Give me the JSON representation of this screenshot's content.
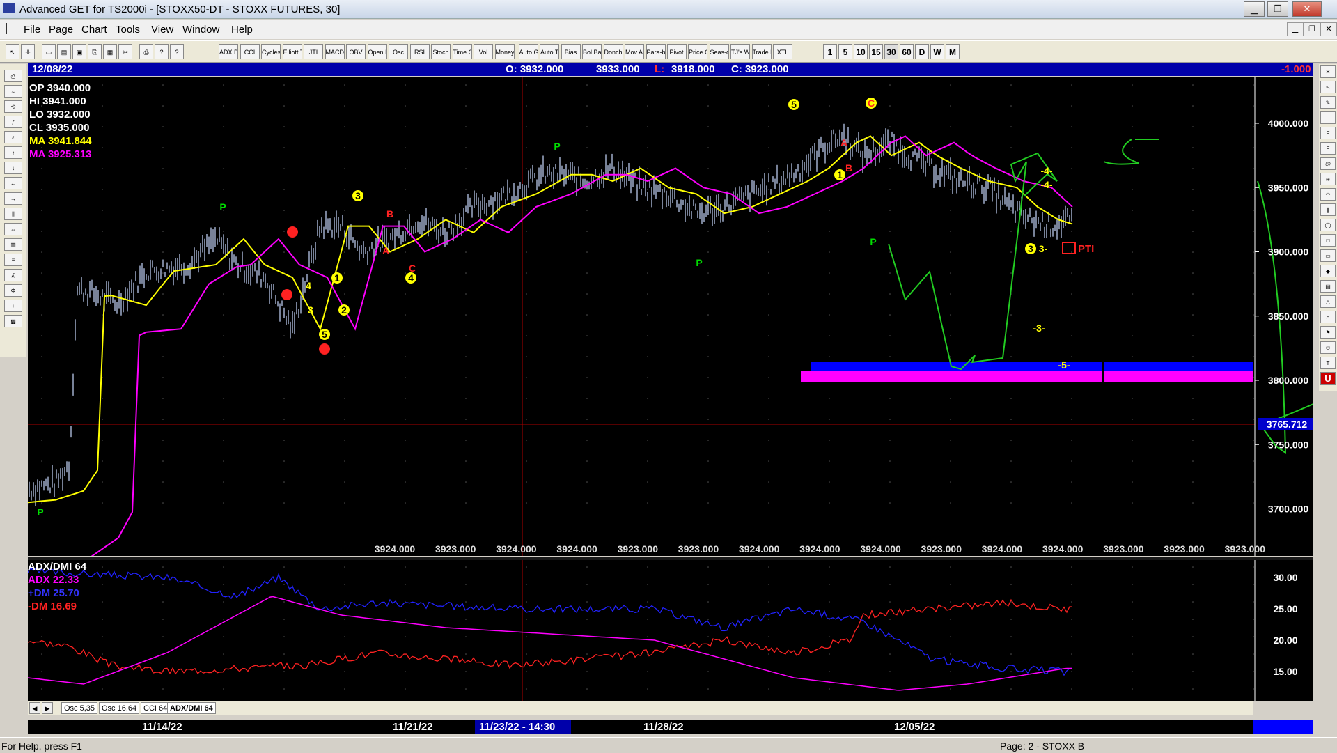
{
  "window": {
    "title": "Advanced GET for TS2000i - [STOXX50-DT - STOXX FUTURES, 30]",
    "btn_min": "▁",
    "btn_max": "❐",
    "btn_close": "✕"
  },
  "menu": [
    "File",
    "Page",
    "Chart",
    "Tools",
    "View",
    "Window",
    "Help"
  ],
  "mdi": {
    "min": "▁",
    "restore": "❐",
    "close": "✕"
  },
  "toolbar": {
    "icons": [
      "pointer-icon",
      "crosshair-icon",
      "new-icon",
      "open-icon",
      "save-icon",
      "copy-icon",
      "grid-icon",
      "cut-icon",
      "print-icon",
      "help-icon",
      "whatis-icon"
    ],
    "studies": [
      "ADX DMI",
      "CCI",
      "Cycles",
      "Elliott Trig",
      "JTI",
      "MACD",
      "OBV",
      "Open Int",
      "Osc",
      "RSI",
      "Stoch",
      "Time Clust",
      "Vol",
      "Money Flow",
      "Auto Gann",
      "Auto Trend",
      "Bias",
      "Bol Band",
      "Donch",
      "Mov Ave",
      "Para-bolic",
      "Pivot",
      "Price Clust",
      "Seas-onals",
      "TJ's Web",
      "Trade Profile",
      "XTL"
    ],
    "intervals": [
      "1",
      "5",
      "10",
      "15",
      "30",
      "60",
      "D",
      "W",
      "M"
    ]
  },
  "leftbar": [
    "print",
    "elliott",
    "reset",
    "study",
    "elliott2",
    "up",
    "down",
    "left",
    "right",
    "bars",
    "fit",
    "ruler",
    "lines",
    "gann",
    "fib",
    "cross",
    "wave"
  ],
  "rightbar": [
    "close",
    "arrow",
    "pen",
    "fib ret",
    "fib ext",
    "fib time",
    "spiral",
    "fan",
    "arc",
    "channel",
    "ellips",
    "square",
    "box",
    "pivot",
    "mob",
    "triangle",
    "zoom",
    "marker",
    "time",
    "text",
    "u"
  ],
  "header": {
    "date": "12/08/22",
    "open": "O: 3932.000",
    "high": "3933.000",
    "low_label": "L:",
    "low_value": "3918.000",
    "close": "C: 3923.000",
    "change": "-1.000"
  },
  "readout": {
    "op": "OP  3940.000",
    "hi": "HI   3941.000",
    "lo": "LO  3932.000",
    "cl": "CL  3935.000",
    "ma1": "MA  3941.844",
    "ma2": "MA  3925.313"
  },
  "price_axis": [
    "4000.000",
    "3950.000",
    "3900.000",
    "3850.000",
    "3800.000",
    "3750.000",
    "3700.000"
  ],
  "crosshair_price": "3765.712",
  "bottom_values": [
    "3924.000",
    "3923.000",
    "3924.000",
    "3924.000",
    "3923.000",
    "3923.000",
    "3924.000",
    "3924.000",
    "3924.000",
    "3923.000",
    "3924.000",
    "3924.000",
    "3923.000",
    "3923.000",
    "3923.000"
  ],
  "annotations": {
    "pti": "PTI",
    "w5": "-5-",
    "w3": "-3-",
    "w4a": "-4-",
    "w4b": "-4-",
    "w3b": "3-",
    "p": "P",
    "c": "C",
    "a": "A",
    "b": "B",
    "n1": "1",
    "n2": "2",
    "n3": "3",
    "n4": "4",
    "n5": "5"
  },
  "osc": {
    "title": "ADX/DMI 64",
    "adx": "ADX 22.33",
    "pdm": "+DM 25.70",
    "mdm": "-DM  16.69",
    "axis": [
      "30.00",
      "25.00",
      "20.00",
      "15.00"
    ]
  },
  "tabs": [
    "Osc 5,35",
    "Osc 16,64",
    "CCI 64",
    "ADX/DMI 64"
  ],
  "dates": [
    "11/14/22",
    "11/21/22",
    "11/23/22 - 14:30",
    "11/28/22",
    "12/05/22"
  ],
  "status": {
    "left": "For Help, press F1",
    "right": "Page: 2 - STOXX B"
  },
  "colors": {
    "header_bg": "#0000aa",
    "ma1": "#ffff00",
    "ma2": "#ff00ff",
    "up": "#00cc00",
    "down": "#ff0000",
    "zone_blue": "#0000ff",
    "zone_pink": "#ff00ff"
  }
}
